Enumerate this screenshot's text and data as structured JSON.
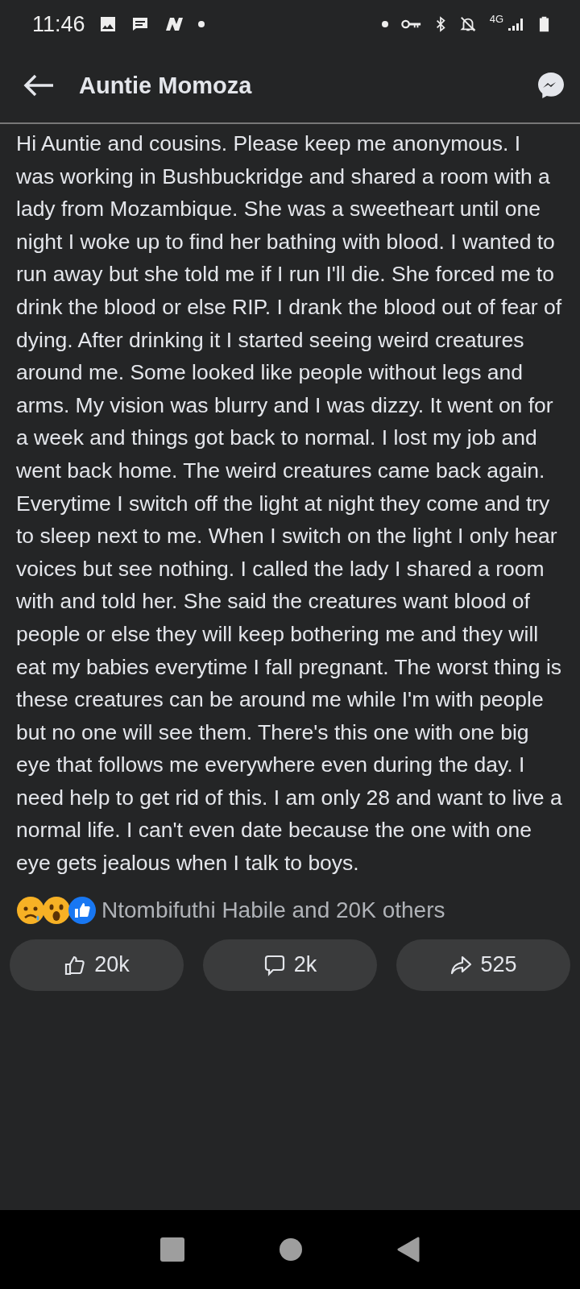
{
  "status_bar": {
    "time": "11:46",
    "network": "4G"
  },
  "header": {
    "title": "Auntie Momoza"
  },
  "post": {
    "text": "Hi Auntie and cousins. Please keep me anonymous. I was working in Bushbuckridge and shared a room with a lady from Mozambique. She was a sweetheart until one night I woke up to find her bathing with blood. I wanted to run away but she told me if I run I'll die. She forced me to drink the blood or else RIP. I drank the blood out of fear of dying. After drinking it I started seeing weird creatures around me. Some looked like people without legs and arms. My vision was blurry and I was dizzy. It went on for a week and things got back to normal. I lost my job and went back home. The weird creatures came back again. Everytime I switch off the light at night they come and try to sleep next to me. When I switch on the light I only hear voices but see nothing. I called the lady I shared a room with and told her. She said the creatures want blood of people or else they will keep bothering me and they will eat my babies everytime I fall pregnant. The worst thing is these creatures can be around me while I'm with people but no one will see them. There's this one with one big eye that follows me everywhere even during the day. I need help to get rid of this. I am only 28 and want to live a normal life. I can't even date because the one with one eye gets jealous when I talk to boys.",
    "reactions": "Ntombifuthi Habile and 20K others"
  },
  "actions": [
    {
      "kind": "like",
      "label": "20k"
    },
    {
      "kind": "comment",
      "label": "2k"
    },
    {
      "kind": "share",
      "label": "525"
    }
  ]
}
